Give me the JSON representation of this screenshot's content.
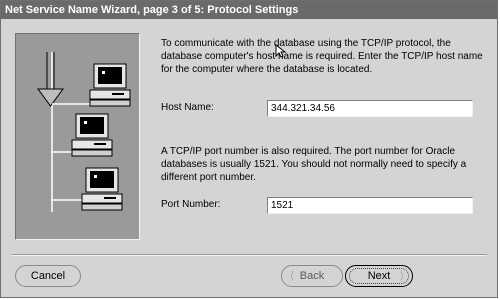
{
  "window": {
    "title": "Net Service Name Wizard, page 3 of 5: Protocol Settings"
  },
  "intro_text": "To communicate with the database using the TCP/IP protocol, the database computer's host name is required.  Enter the TCP/IP host name for the computer where the database is located.",
  "host": {
    "label": "Host Name:",
    "value": "344.321.34.56"
  },
  "port_text": "A TCP/IP port number is also required.  The port number for Oracle databases is usually 1521.  You should not normally need to specify a different port number.",
  "port": {
    "label": "Port Number:",
    "value": "1521"
  },
  "buttons": {
    "cancel": "Cancel",
    "back": "Back",
    "next": "Next"
  },
  "illustration": {
    "icon": "network-computers-icon"
  }
}
